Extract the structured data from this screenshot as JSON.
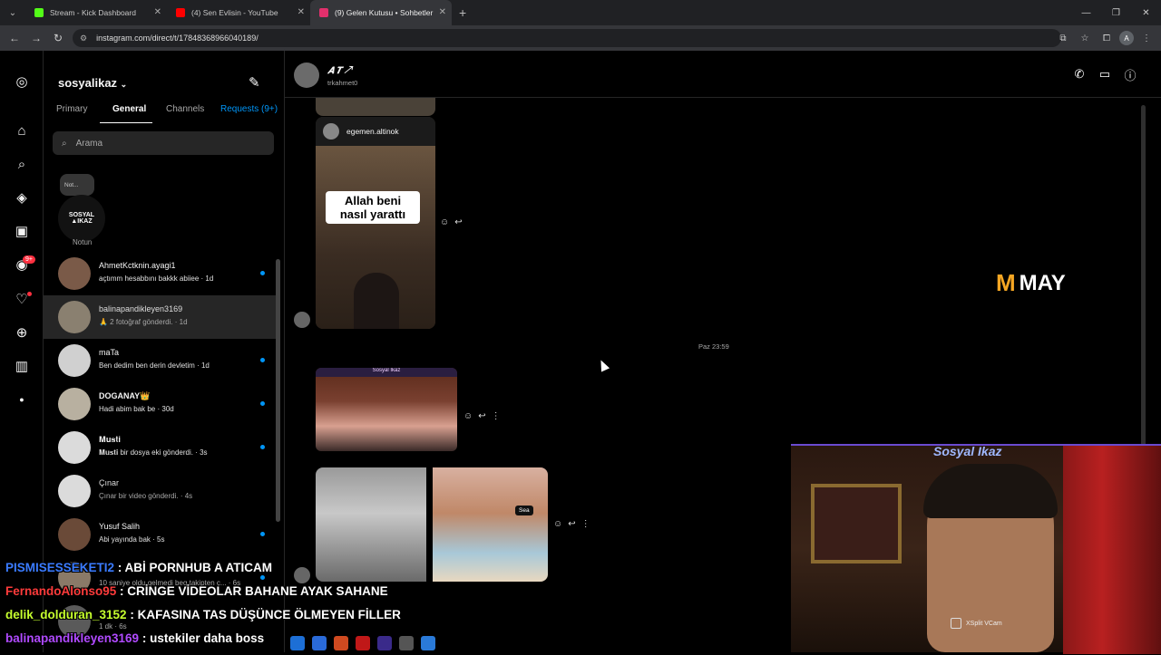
{
  "browser": {
    "tabs": [
      {
        "label": "Stream - Kick Dashboard",
        "color": "#53fc18"
      },
      {
        "label": "(4) Sen Evlisin - YouTube",
        "color": "#ff0000"
      },
      {
        "label": "(9) Gelen Kutusu • Sohbetler",
        "color": "#e1306c"
      }
    ],
    "url": "instagram.com/direct/t/17848368966040189/",
    "profile_initial": "A"
  },
  "rail": {
    "icons": [
      "instagram-logo-icon",
      "home-icon",
      "search-icon",
      "explore-icon",
      "reels-icon",
      "messenger-icon",
      "heart-icon",
      "create-icon",
      "dashboard-icon",
      "profile-icon"
    ],
    "messages_badge": "9+"
  },
  "inbox": {
    "account": "sosyalikaz",
    "tabs": {
      "primary": "Primary",
      "general": "General",
      "channels": "Channels",
      "requests": "Requests (9+)"
    },
    "search_placeholder": "Arama",
    "note": {
      "bubble": "Not...",
      "logo_line1": "SOSYAL",
      "logo_line2": "▲IKAZ",
      "label": "Notun"
    },
    "conversations": [
      {
        "name": "AhmetKctknin.ayagi1",
        "message": "açtımm hesabbını bakkk abiiee · 1d",
        "unread": true,
        "avatar_color": "#7a5a48"
      },
      {
        "name": "balinapandikleyen3169",
        "message": "🙏 2 fotoğraf gönderdi. · 1d",
        "unread": false,
        "avatar_color": "#8a8070"
      },
      {
        "name": "maTa",
        "message": "Ben dedim ben derin devletim · 1d",
        "unread": true,
        "avatar_color": "#d0d0d0"
      },
      {
        "name": "DOGANAY👑",
        "message": "Hadi abim bak be · 30d",
        "unread": true,
        "avatar_color": "#b8b0a0"
      },
      {
        "name": "𝐌𝐮𝐬𝐭𝐢",
        "message": "𝐌𝐮𝐬𝐭𝐢 bir dosya eki gönderdi. · 3s",
        "unread": true,
        "avatar_color": "#dbdbdb"
      },
      {
        "name": "Çınar",
        "message": "Çınar bir video gönderdi. · 4s",
        "unread": false,
        "avatar_color": "#dbdbdb"
      },
      {
        "name": "Yusuf Salih",
        "message": "Abi yayında bak · 5s",
        "unread": true,
        "avatar_color": "#6a4a38"
      },
      {
        "name": "",
        "message": "10 saniye oldu gelmedi beg takipten ç... · 6s",
        "unread": false,
        "avatar_color": "#8a7a68"
      },
      {
        "name": "",
        "message": "1 dk · 6s",
        "unread": false,
        "avatar_color": "#5a5a5a"
      }
    ]
  },
  "chat": {
    "header_name": "𝑨 𝑻 ↗",
    "header_username": "trkahmet0",
    "reel_author": "egemen.altinok",
    "reel_caption": "Allah beni nasıl yarattı",
    "timestamp": "Paz 23:59",
    "photo_header": "Sosyal Ikaz",
    "sea_tag": "Sea"
  },
  "watermark": "MAY",
  "webcam": {
    "title": "Sosyal Ikaz",
    "label": "XSplit VCam"
  },
  "stream_chat": [
    {
      "user": "PISMISESSEKETI2",
      "text": ": ABİ PORNHUB A ATICAM",
      "color": "#3a7bff"
    },
    {
      "user": "FernandoAlonso95",
      "text": ": CRİNGE VİDEOLAR BAHANE AYAK SAHANE",
      "color": "#ff3b3b"
    },
    {
      "user": "delik_dolduran_3152",
      "text": ": KAFASINA TAS DÜŞÜNCE ÖLMEYEN FİLLER",
      "color": "#c6ff2e"
    },
    {
      "user": "balinapandikleyen3169",
      "text": ": ustekiler daha boss",
      "color": "#b04aff"
    }
  ]
}
